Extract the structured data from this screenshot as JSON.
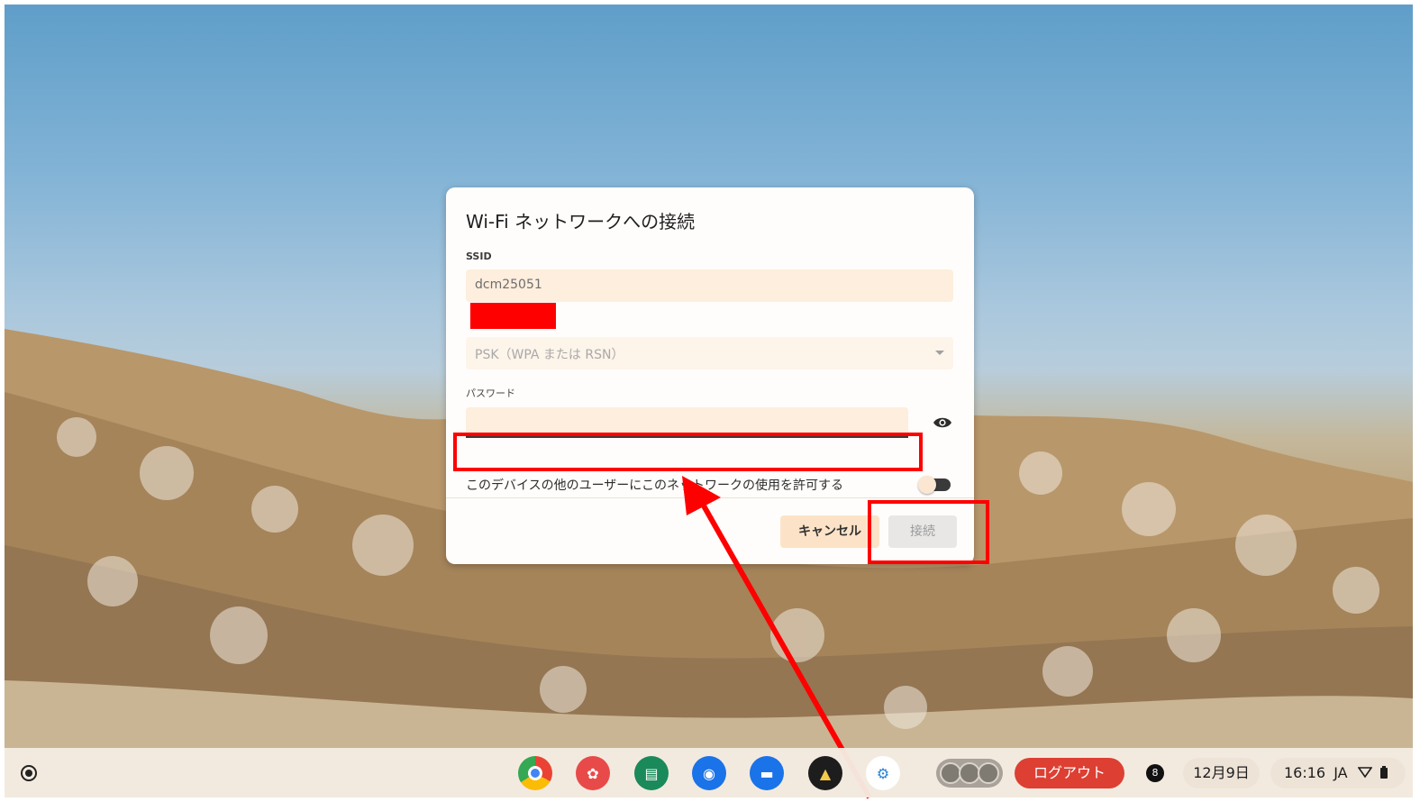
{
  "dialog": {
    "title": "Wi-Fi ネットワークへの接続",
    "ssid_label": "SSID",
    "ssid_value": "dcm25051",
    "security_value": "PSK（WPA または RSN）",
    "password_label": "パスワード",
    "password_value": "",
    "allow_label": "このデバイスの他のユーザーにこのネットワークの使用を許可する",
    "allow_enabled": true,
    "cancel_label": "キャンセル",
    "connect_label": "接続"
  },
  "shelf": {
    "apps": [
      "chrome-icon",
      "canvas-icon",
      "classroom-icon",
      "camera-icon",
      "files-icon",
      "school-app-icon",
      "settings-icon"
    ],
    "logout_label": "ログアウト",
    "notification_count": "8",
    "date": "12月9日",
    "time": "16:16",
    "ime": "JA"
  },
  "colors": {
    "annotation": "#ff0000",
    "logout": "#dd3f33",
    "field_bg": "#fdeedd"
  }
}
